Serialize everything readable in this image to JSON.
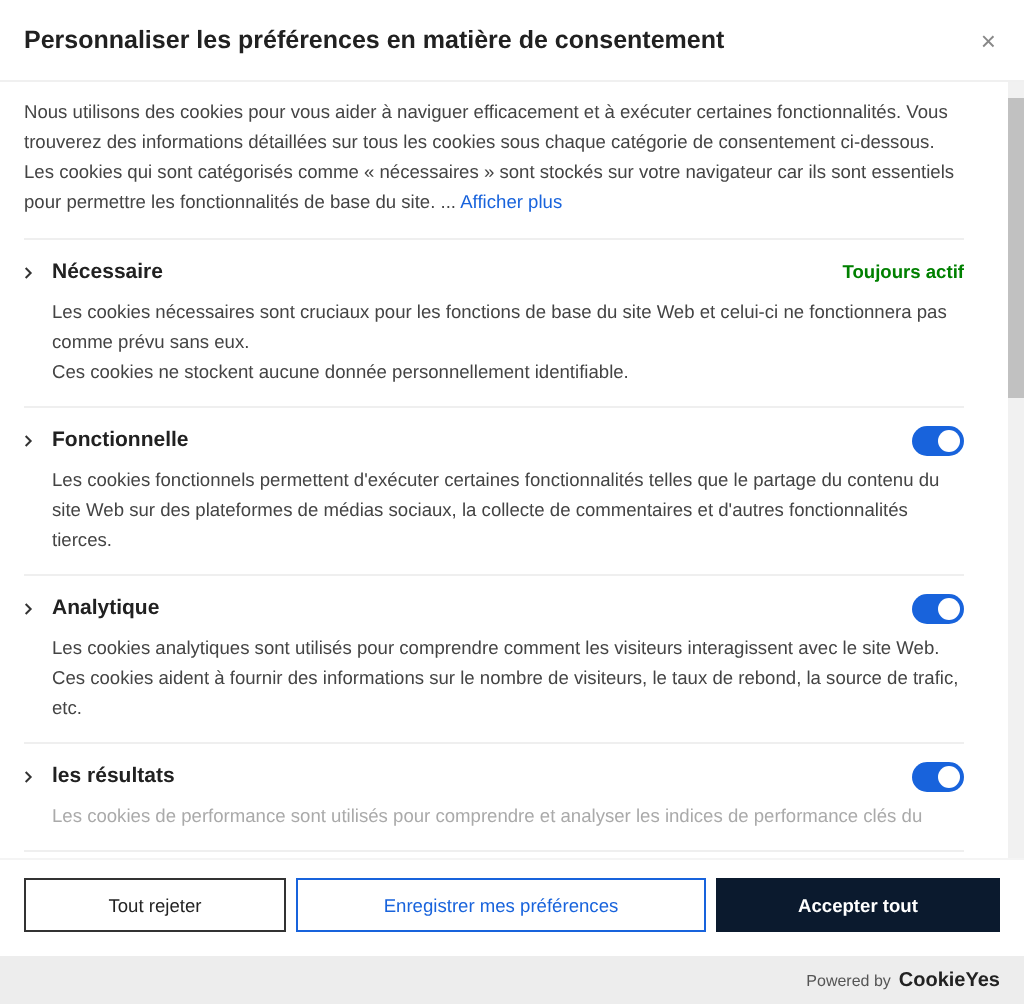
{
  "dialog": {
    "title": "Personnaliser les préférences en matière de consentement",
    "close": "×"
  },
  "intro": {
    "lines": [
      "Nous utilisons des cookies pour vous aider à naviguer efficacement et à exécuter certaines fonctionnalités. Vous trouverez des informations détaillées sur tous les cookies sous chaque catégorie de consentement ci-dessous.",
      "Les cookies qui sont catégorisés comme « nécessaires » sont stockés sur votre navigateur car ils sont essentiels pour permettre les fonctionnalités de base du site. ..."
    ],
    "link": "Afficher plus"
  },
  "categories": [
    {
      "kind": "always",
      "title": "Nécessaire",
      "status": "Toujours actif",
      "description": [
        "Les cookies nécessaires sont cruciaux pour les fonctions de base du site Web et celui-ci ne fonctionnera pas comme prévu sans eux.",
        "Ces cookies ne stockent aucune donnée personnellement identifiable."
      ]
    },
    {
      "kind": "toggle",
      "title": "Fonctionnelle",
      "on": true,
      "description": [
        "Les cookies fonctionnels permettent d'exécuter certaines fonctionnalités telles que le partage du contenu du site Web sur des plateformes de médias sociaux, la collecte de commentaires et d'autres fonctionnalités tierces."
      ]
    },
    {
      "kind": "toggle",
      "title": "Analytique",
      "on": true,
      "description": [
        "Les cookies analytiques sont utilisés pour comprendre comment les visiteurs interagissent avec le site Web. Ces cookies aident à fournir des informations sur le nombre de visiteurs, le taux de rebond, la source de trafic, etc."
      ]
    },
    {
      "kind": "toggle",
      "title": "les résultats",
      "on": true,
      "description": [
        "Les cookies de performance sont utilisés pour comprendre et analyser les indices de performance clés du"
      ]
    }
  ],
  "buttons": [
    {
      "kind": "outline",
      "label": "Tout rejeter"
    },
    {
      "kind": "link",
      "label": "Enregistrer mes préférences"
    },
    {
      "kind": "solid",
      "label": "Accepter tout"
    }
  ],
  "footer": {
    "prefix": "Powered by",
    "brand": "CookieYes"
  }
}
